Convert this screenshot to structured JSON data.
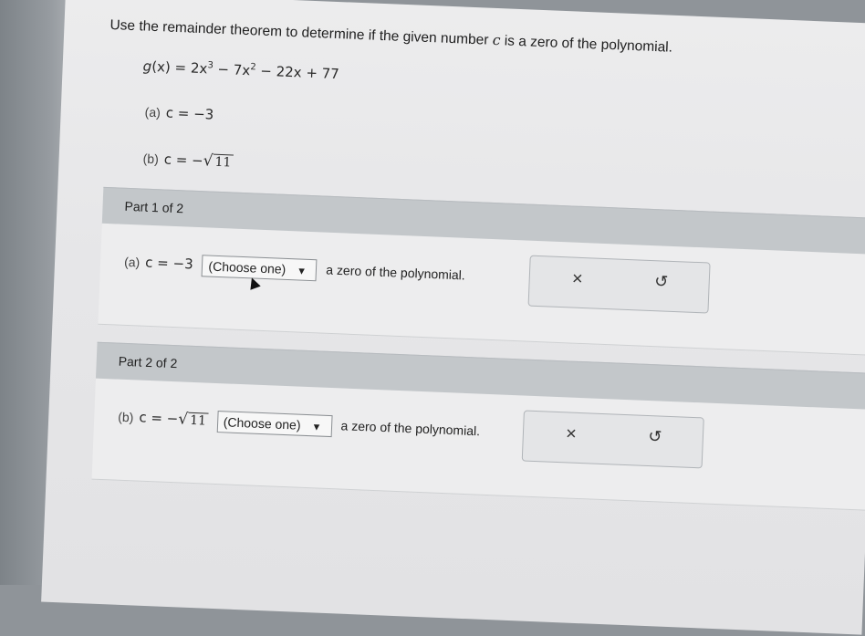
{
  "question": {
    "prompt_pre": "Use the remainder theorem to determine if the given number ",
    "prompt_var": "c",
    "prompt_post": " is a zero of the polynomial.",
    "poly_lhs": "g",
    "poly_arg": "(x)",
    "poly_eq": " = 2x",
    "poly_exp1": "3",
    "poly_mid": " − 7x",
    "poly_exp2": "2",
    "poly_end": " − 22x + 77",
    "item_a_label": "(a)",
    "item_a_value": "c = −3",
    "item_b_label": "(b)",
    "item_b_value": "c = −",
    "item_b_radicand": "11"
  },
  "parts": [
    {
      "header": "Part 1 of 2",
      "label": "(a)",
      "value": "c = −3",
      "select_value": "(Choose one)",
      "suffix": "a zero of the polynomial."
    },
    {
      "header": "Part 2 of 2",
      "label": "(b)",
      "value": "c = −",
      "radicand": "11",
      "select_value": "(Choose one)",
      "suffix": "a zero of the polynomial."
    }
  ],
  "icons": {
    "clear": "×",
    "undo": "↺",
    "dropdown": "▼",
    "sqrt": "√"
  }
}
